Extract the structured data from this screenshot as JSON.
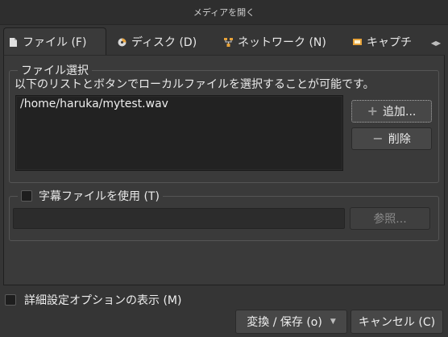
{
  "window": {
    "title": "メディアを開く"
  },
  "tabs": [
    {
      "label": "ファイル (F)",
      "icon": "file-icon",
      "active": true
    },
    {
      "label": "ディスク (D)",
      "icon": "disc-icon",
      "active": false
    },
    {
      "label": "ネットワーク (N)",
      "icon": "network-icon",
      "active": false
    },
    {
      "label": "キャプチ",
      "icon": "capture-icon",
      "active": false
    }
  ],
  "file_selection": {
    "group_title": "ファイル選択",
    "description": "以下のリストとボタンでローカルファイルを選択することが可能です。",
    "files": [
      "/home/haruka/mytest.wav"
    ],
    "add_label": "追加...",
    "remove_label": "削除"
  },
  "subtitle": {
    "checkbox_label": "字幕ファイルを使用 (T)",
    "checked": false,
    "path_value": "",
    "browse_label": "参照..."
  },
  "advanced": {
    "label": "詳細設定オプションの表示 (M)",
    "checked": false
  },
  "footer": {
    "convert_label": "変換 / 保存 (o)",
    "cancel_label": "キャンセル (C)"
  },
  "colors": {
    "background": "#353535",
    "panel": "#3a3a3a",
    "list_bg": "#222222",
    "button": "#474747"
  }
}
